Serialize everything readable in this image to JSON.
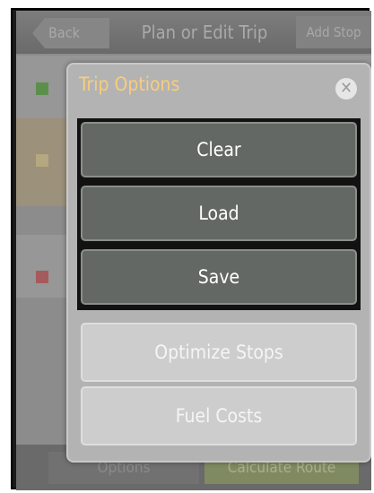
{
  "app": {
    "back_label": "Back",
    "title": "Plan or Edit Trip",
    "add_stop_label": "Add Stop",
    "options_label": "Options",
    "calculate_label": "Calculate Route"
  },
  "dialog": {
    "title": "Trip Options",
    "close_icon": "close-icon",
    "buttons": [
      {
        "label": "Clear"
      },
      {
        "label": "Load"
      },
      {
        "label": "Save"
      },
      {
        "label": "Optimize Stops"
      },
      {
        "label": "Fuel Costs"
      }
    ]
  }
}
